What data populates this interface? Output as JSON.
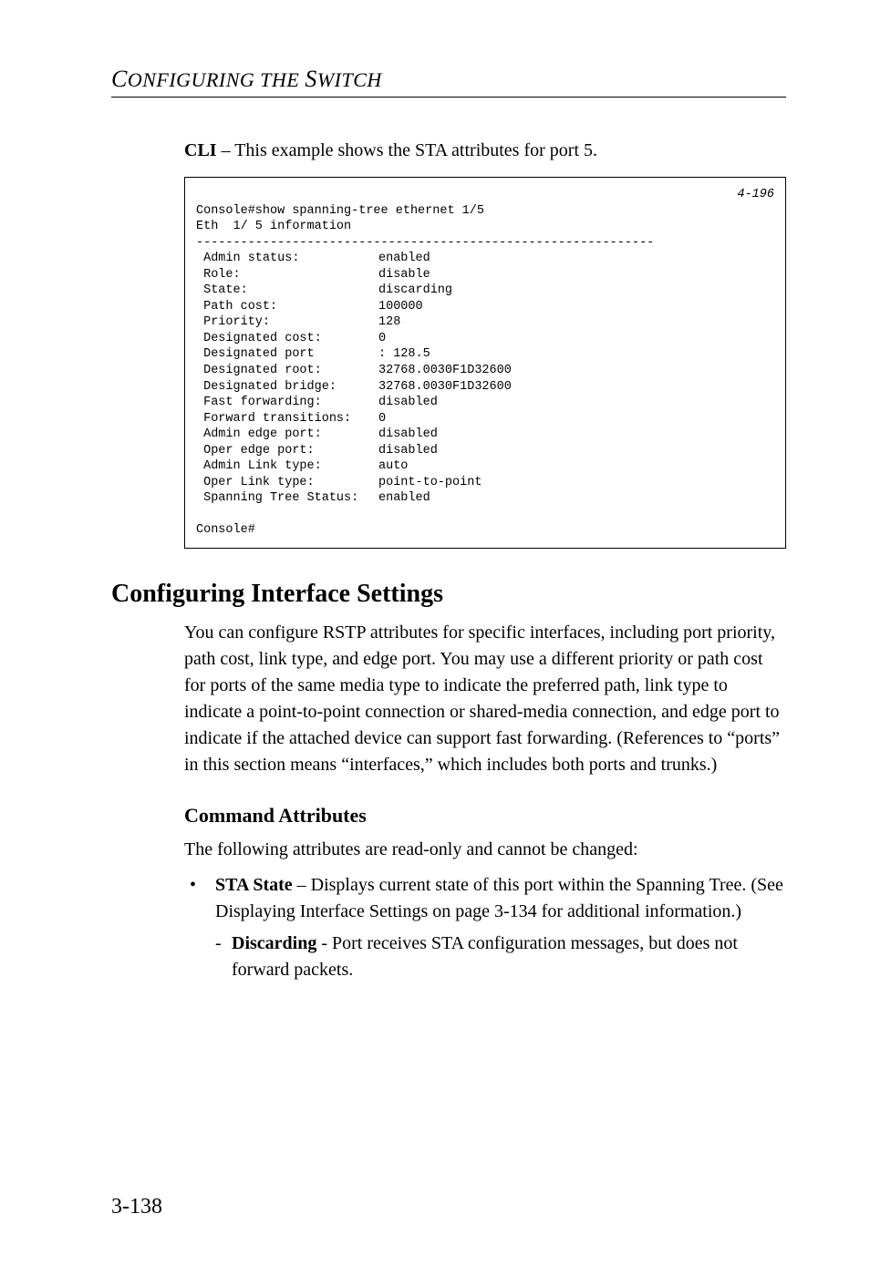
{
  "runningHead": {
    "c": "C",
    "word1": "ONFIGURING",
    "the": " THE ",
    "s": "S",
    "word2": "WITCH"
  },
  "cliIntro": {
    "strong": "CLI",
    "rest": " – This example shows the STA attributes for port 5."
  },
  "cli": {
    "line1": "Console#show spanning-tree ethernet 1/5",
    "ref": "4-196",
    "line2": "Eth  1/ 5 information",
    "rule": "--------------------------------------------------------------",
    "rows": [
      {
        "label": " Admin status:",
        "value": "enabled"
      },
      {
        "label": " Role:",
        "value": "disable"
      },
      {
        "label": " State:",
        "value": "discarding"
      },
      {
        "label": " Path cost:",
        "value": "100000"
      },
      {
        "label": " Priority:",
        "value": "128"
      },
      {
        "label": " Designated cost:",
        "value": "0"
      },
      {
        "label": " Designated port",
        "value": ": 128.5"
      },
      {
        "label": " Designated root:",
        "value": "32768.0030F1D32600"
      },
      {
        "label": " Designated bridge:",
        "value": "32768.0030F1D32600"
      },
      {
        "label": " Fast forwarding:",
        "value": "disabled"
      },
      {
        "label": " Forward transitions:",
        "value": "0"
      },
      {
        "label": " Admin edge port:",
        "value": "disabled"
      },
      {
        "label": " Oper edge port:",
        "value": "disabled"
      },
      {
        "label": " Admin Link type:",
        "value": "auto"
      },
      {
        "label": " Oper Link type:",
        "value": "point-to-point"
      },
      {
        "label": " Spanning Tree Status:",
        "value": "enabled"
      }
    ],
    "blank": "",
    "prompt": "Console#"
  },
  "h2": "Configuring Interface Settings",
  "body": "You can configure RSTP attributes for specific interfaces, including port priority, path cost, link type, and edge port. You may use a different priority or path cost for ports of the same media type to indicate the preferred path, link type to indicate a point-to-point connection or shared-media connection, and edge port to indicate if the attached device can support fast forwarding. (References to “ports” in this section means “interfaces,” which includes both ports and trunks.)",
  "h3": "Command Attributes",
  "body2": "The following attributes are read-only and cannot be changed:",
  "bullet1": {
    "strong": "STA State",
    "rest": " – Displays current state of this port within the Spanning Tree. (See Displaying Interface Settings on page 3-134 for additional information.)"
  },
  "sub1": {
    "strong": "Discarding",
    "rest": " - Port receives STA configuration messages, but does not forward packets."
  },
  "pageNum": "3-138"
}
